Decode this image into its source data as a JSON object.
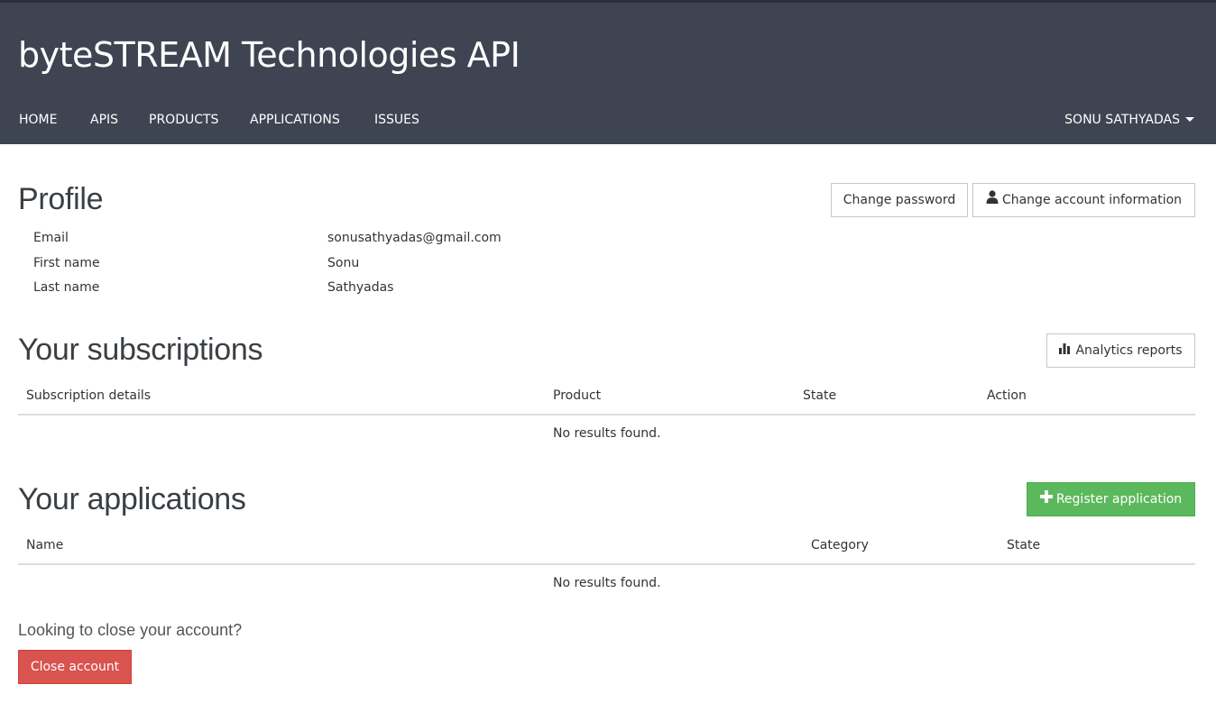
{
  "header": {
    "site_title": "byteSTREAM Technologies API",
    "nav": [
      "HOME",
      "APIS",
      "PRODUCTS",
      "APPLICATIONS",
      "ISSUES"
    ],
    "user_menu": "SONU SATHYADAS"
  },
  "profile": {
    "title": "Profile",
    "change_password": "Change password",
    "change_account": "Change account information",
    "fields": [
      {
        "label": "Email",
        "value": "sonusathyadas@gmail.com"
      },
      {
        "label": "First name",
        "value": "Sonu"
      },
      {
        "label": "Last name",
        "value": "Sathyadas"
      }
    ]
  },
  "subscriptions": {
    "title": "Your subscriptions",
    "analytics_button": "Analytics reports",
    "columns": [
      "Subscription details",
      "Product",
      "State",
      "Action"
    ],
    "empty": "No results found."
  },
  "applications": {
    "title": "Your applications",
    "register_button": "Register application",
    "columns": [
      "Name",
      "Category",
      "State"
    ],
    "empty": "No results found."
  },
  "close_account": {
    "question": "Looking to close your account?",
    "button": "Close account"
  },
  "colors": {
    "header_bg": "#3e4451",
    "green": "#5cb85c",
    "red": "#d9534f"
  }
}
